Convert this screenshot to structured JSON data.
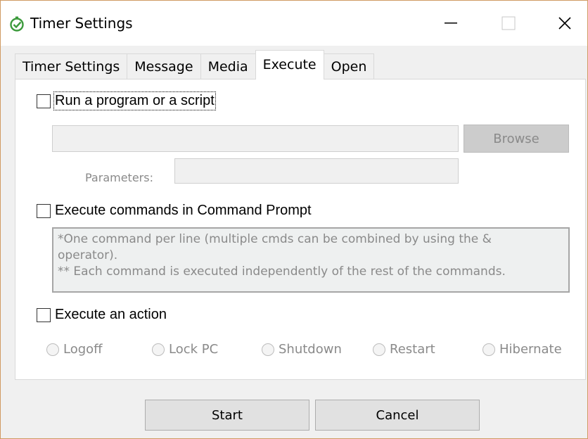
{
  "window": {
    "title": "Timer Settings",
    "app_icon": "timer-check-icon",
    "accent_color": "#3c9a3c"
  },
  "tabs": [
    {
      "label": "Timer Settings",
      "active": false
    },
    {
      "label": "Message",
      "active": false
    },
    {
      "label": "Media",
      "active": false
    },
    {
      "label": "Execute",
      "active": true
    },
    {
      "label": "Open",
      "active": false
    }
  ],
  "execute": {
    "run_program": {
      "label": "Run a program or a script",
      "checked": false
    },
    "program_path": {
      "value": ""
    },
    "browse_label": "Browse",
    "parameters_label": "Parameters:",
    "parameters_value": "",
    "command_prompt": {
      "label": "Execute commands in Command Prompt",
      "checked": false
    },
    "command_hint_1": "*One command per line (multiple cmds can be combined by using the &",
    "command_hint_2": "operator).",
    "command_hint_3": "** Each command is executed independently of the rest of the commands.",
    "action": {
      "label": "Execute an action",
      "checked": false
    },
    "action_options": [
      "Logoff",
      "Lock PC",
      "Shutdown",
      "Restart",
      "Hibernate"
    ]
  },
  "footer": {
    "start_label": "Start",
    "cancel_label": "Cancel"
  }
}
